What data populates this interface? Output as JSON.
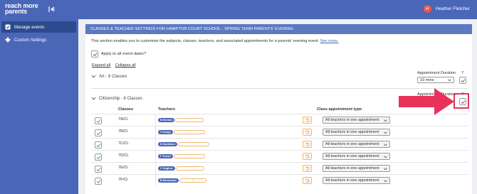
{
  "app": {
    "logo_line1": "reach more",
    "logo_line2": "parents"
  },
  "user": {
    "initial": "H",
    "name": "Heather Fletcher"
  },
  "sidebar": {
    "items": [
      {
        "label": "Manage events",
        "icon": "checklist-icon",
        "active": true
      },
      {
        "label": "Custom Settings",
        "icon": "gear-icon",
        "active": false
      }
    ]
  },
  "main": {
    "header": "CLASSES & TEACHER SETTINGS FOR HAMPTON COURT SCHOOL - SPRING TERM PARENTS' EVENING",
    "description": "This section enables you to customise the subjects, classes, teachers, and associated appointments for a parents' evening event.",
    "see_more": "See more.",
    "apply_label": "Apply to all event dates?",
    "expand_all": "Expand all",
    "collapse_all": "Collapse all"
  },
  "sections": [
    {
      "title": "Art - 6 Classes",
      "duration_label": "Appointment Duration",
      "duration_value": "10 mins",
      "duration_num": "7"
    },
    {
      "title": "Citizenship - 6 Classes",
      "duration_label": "Appointment Duration",
      "duration_num": "7"
    }
  ],
  "table": {
    "headers": {
      "classes": "Classes",
      "teachers": "Teachers",
      "type": "Class appointment type"
    },
    "rows": [
      {
        "code": "7A/Ci",
        "teacher": "B Kiemes",
        "type": "All teachers in one appointment"
      },
      {
        "code": "7B/Ci",
        "teacher": "J Young",
        "type": "All teachers in one appointment"
      },
      {
        "code": "7C/Ci",
        "teacher": "D Davidson",
        "type": "All teachers in one appointment"
      },
      {
        "code": "7D/Ci",
        "teacher": "F Turner",
        "type": "All teachers in one appointment"
      },
      {
        "code": "7E/Ci",
        "teacher": "C Hughes",
        "type": "All teachers in one appointment"
      },
      {
        "code": "7F/Ci",
        "teacher": "B Mcnamara",
        "type": "All teachers in one appointment"
      }
    ]
  },
  "colors": {
    "brand": "#4a66b7",
    "header_bar": "#5b78c3",
    "accent_arrow": "#e8325a",
    "check_green": "#3f9a47"
  }
}
